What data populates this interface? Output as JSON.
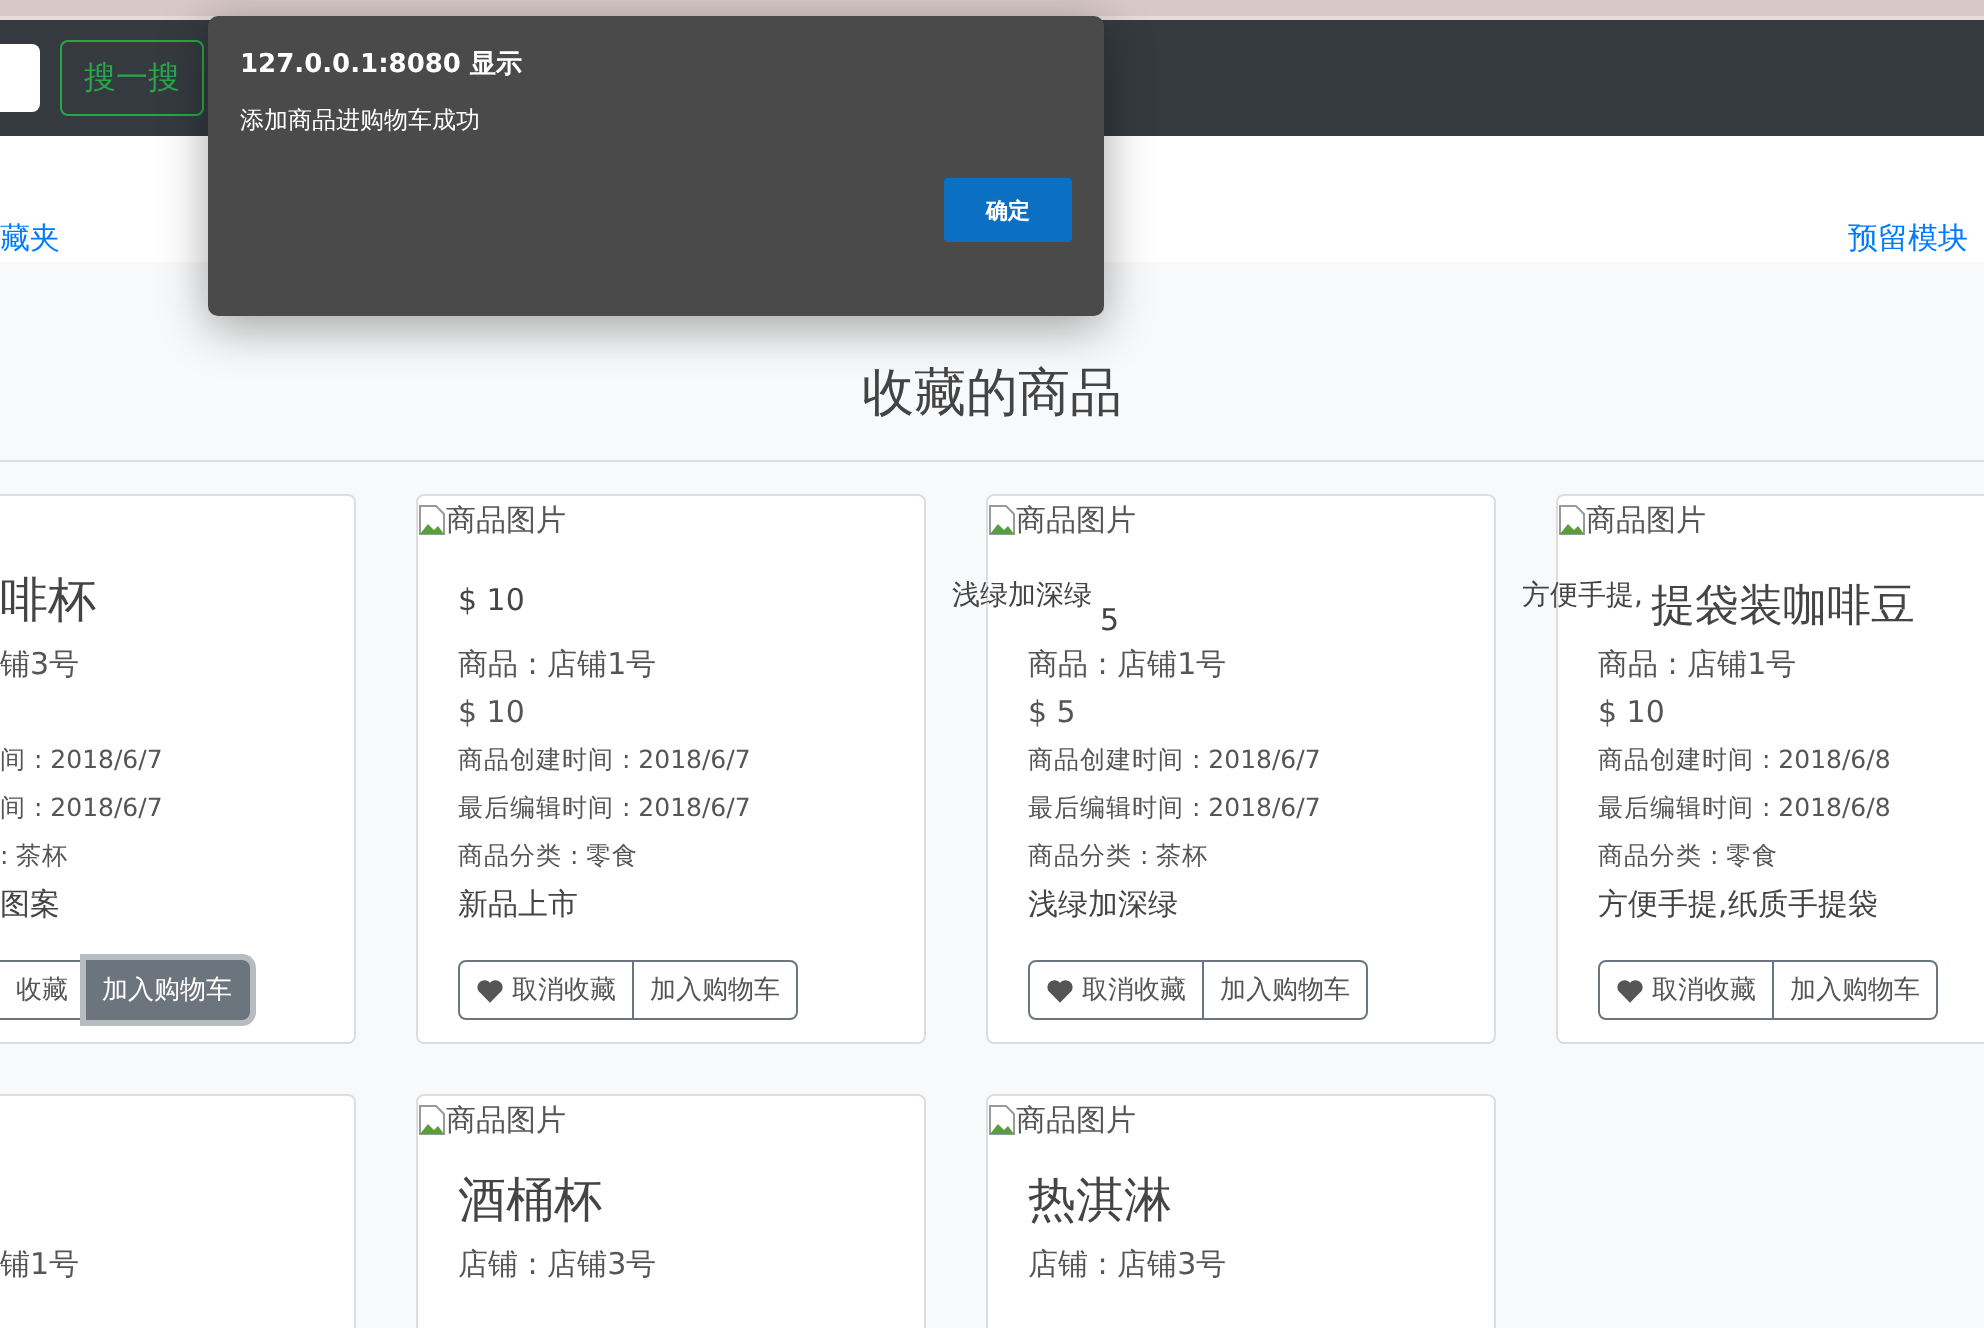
{
  "navbar": {
    "search_button": "搜一搜"
  },
  "links": {
    "left": "藏夹",
    "right": "预留模块"
  },
  "heading": "收藏的商品",
  "rows": [
    [
      {
        "cut": true,
        "title": "啡杯",
        "shop": "铺3号",
        "created": "间 : 2018/6/7",
        "edited": "间 : 2018/6/7",
        "category": ": 茶杯",
        "description": "图案",
        "buttons": [
          {
            "kind": "unfavorite",
            "label": "收藏",
            "focused": false
          },
          {
            "kind": "cart",
            "label": "加入购物车",
            "focused": true
          }
        ]
      },
      {
        "cut": false,
        "image_alt": "商品图片",
        "title": "$ 10",
        "shop": "商品 : 店铺1号",
        "price": "$ 10",
        "created": "商品创建时间 : 2018/6/7",
        "edited": "最后编辑时间 : 2018/6/7",
        "category": "商品分类 : 零食",
        "description": "新品上市",
        "buttons": [
          {
            "kind": "unfavorite",
            "label": "取消收藏",
            "focused": false
          },
          {
            "kind": "cart",
            "label": "加入购物车",
            "focused": false
          }
        ]
      },
      {
        "cut": false,
        "image_alt": "商品图片",
        "floating": "浅绿加深绿",
        "title": "5",
        "shop": "商品 : 店铺1号",
        "price": "$ 5",
        "created": "商品创建时间 : 2018/6/7",
        "edited": "最后编辑时间 : 2018/6/7",
        "category": "商品分类 : 茶杯",
        "description": "浅绿加深绿",
        "buttons": [
          {
            "kind": "unfavorite",
            "label": "取消收藏",
            "focused": false
          },
          {
            "kind": "cart",
            "label": "加入购物车",
            "focused": false
          }
        ]
      },
      {
        "cut": false,
        "image_alt": "商品图片",
        "floating": "方便手提,",
        "title": "提袋装咖啡豆",
        "shop": "商品 : 店铺1号",
        "price": "$ 10",
        "created": "商品创建时间 : 2018/6/8",
        "edited": "最后编辑时间 : 2018/6/8",
        "category": "商品分类 : 零食",
        "description": "方便手提,纸质手提袋",
        "buttons": [
          {
            "kind": "unfavorite",
            "label": "取消收藏",
            "focused": false
          },
          {
            "kind": "cart",
            "label": "加入购物车",
            "focused": false
          }
        ]
      }
    ],
    [
      {
        "cut": true,
        "shop": "铺1号"
      },
      {
        "cut": false,
        "image_alt": "商品图片",
        "title": "酒桶杯",
        "shop": "店铺 : 店铺3号"
      },
      {
        "cut": false,
        "image_alt": "商品图片",
        "title": "热淇淋",
        "shop": "店铺 : 店铺3号"
      }
    ]
  ],
  "dialog": {
    "title": "127.0.0.1:8080 显示",
    "message": "添加商品进购物车成功",
    "button": "确定"
  }
}
